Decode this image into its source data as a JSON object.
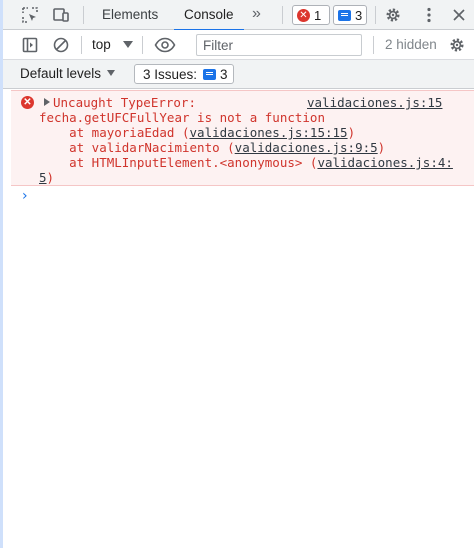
{
  "tabs": {
    "elements": "Elements",
    "console": "Console",
    "more": "»"
  },
  "badges": {
    "errors_count": "1",
    "issues_count": "3"
  },
  "toolbar": {
    "context": "top",
    "filter_placeholder": "Filter",
    "hidden": "2 hidden"
  },
  "levels": {
    "label": "Default levels",
    "issues_label": "3 Issues:",
    "issues_count": "3"
  },
  "error": {
    "type": "Uncaught TypeError:",
    "source": "validaciones.js:15",
    "message": "fecha.getUFCFullYear is not a function",
    "frames": [
      {
        "prefix": "    at mayoriaEdad (",
        "link": "validaciones.js:15:15",
        "suffix": ")"
      },
      {
        "prefix": "    at validarNacimiento (",
        "link": "validaciones.js:9:5",
        "suffix": ")"
      },
      {
        "prefix": "    at HTMLInputElement.<anonymous> (",
        "link": "validaciones.js:4:",
        "suffix": ""
      }
    ],
    "wrap_link": "5",
    "wrap_suffix": ")"
  },
  "prompt_symbol": "›",
  "colors": {
    "error_text": "#d0342c",
    "error_bg": "#fdf2f2",
    "accent": "#1a73e8"
  }
}
